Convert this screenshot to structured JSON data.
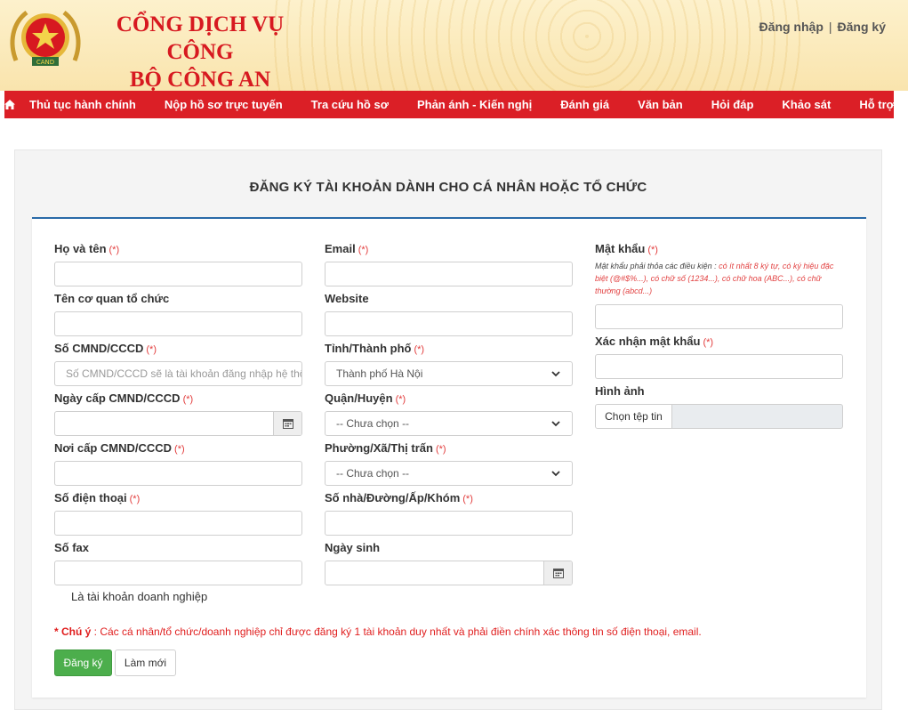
{
  "brand": {
    "line1": "CỔNG DỊCH VỤ CÔNG",
    "line2": "BỘ CÔNG AN",
    "logo_icon": "police-emblem-icon"
  },
  "auth": {
    "login": "Đăng nhập",
    "separator": "|",
    "register": "Đăng ký"
  },
  "nav": {
    "home_icon": "home-icon",
    "items": [
      "Thủ tục hành chính",
      "Nộp hồ sơ trực tuyến",
      "Tra cứu hồ sơ",
      "Phản ánh - Kiến nghị",
      "Đánh giá",
      "Văn bản",
      "Hỏi đáp",
      "Khảo sát",
      "Hỗ trợ"
    ]
  },
  "form": {
    "title": "ĐĂNG KÝ TÀI KHOẢN DÀNH CHO CÁ NHÂN HOẶC TỔ CHỨC",
    "required_mark": "(*)",
    "col1": {
      "full_name": "Họ và tên",
      "organization": "Tên cơ quan tổ chức",
      "id_number": "Số CMND/CCCD",
      "id_placeholder": "Số CMND/CCCD sẽ là tài khoản đăng nhập hệ thống",
      "issue_date": "Ngày cấp CMND/CCCD",
      "issue_place": "Nơi cấp CMND/CCCD",
      "phone": "Số điện thoại",
      "fax": "Số fax"
    },
    "col2": {
      "email": "Email",
      "website": "Website",
      "province": "Tỉnh/Thành phố",
      "province_value": "Thành phố Hà Nội",
      "district": "Quận/Huyện",
      "district_value": "-- Chưa chọn --",
      "ward": "Phường/Xã/Thị trấn",
      "ward_value": "-- Chưa chọn --",
      "address": "Số nhà/Đường/Ấp/Khóm",
      "birthday": "Ngày sinh"
    },
    "col3": {
      "password": "Mật khẩu",
      "password_hint_lead": "Mật khẩu phải thỏa các điều kiện : ",
      "password_hint": "có ít nhất 8 ký tự, có ký hiệu đặc biệt (@#$%...), có chữ số (1234...), có chữ hoa (ABC...), có chữ thường (abcd...)",
      "confirm_password": "Xác nhận mật khẩu",
      "image": "Hình ảnh",
      "choose_file": "Chọn tệp tin"
    },
    "business_account": "Là tài khoản doanh nghiệp",
    "note_prefix": "* Chú ý",
    "note_text": " : Các cá nhân/tổ chức/doanh nghiệp chỉ được đăng ký 1 tài khoản duy nhất và phải điền chính xác thông tin số điện thoại, email.",
    "submit": "Đăng ký",
    "reset": "Làm mới"
  },
  "colors": {
    "nav_red": "#db1f26",
    "brand_red": "#d71920",
    "accent_blue": "#2a6aa8",
    "submit_green": "#4cae4c"
  }
}
